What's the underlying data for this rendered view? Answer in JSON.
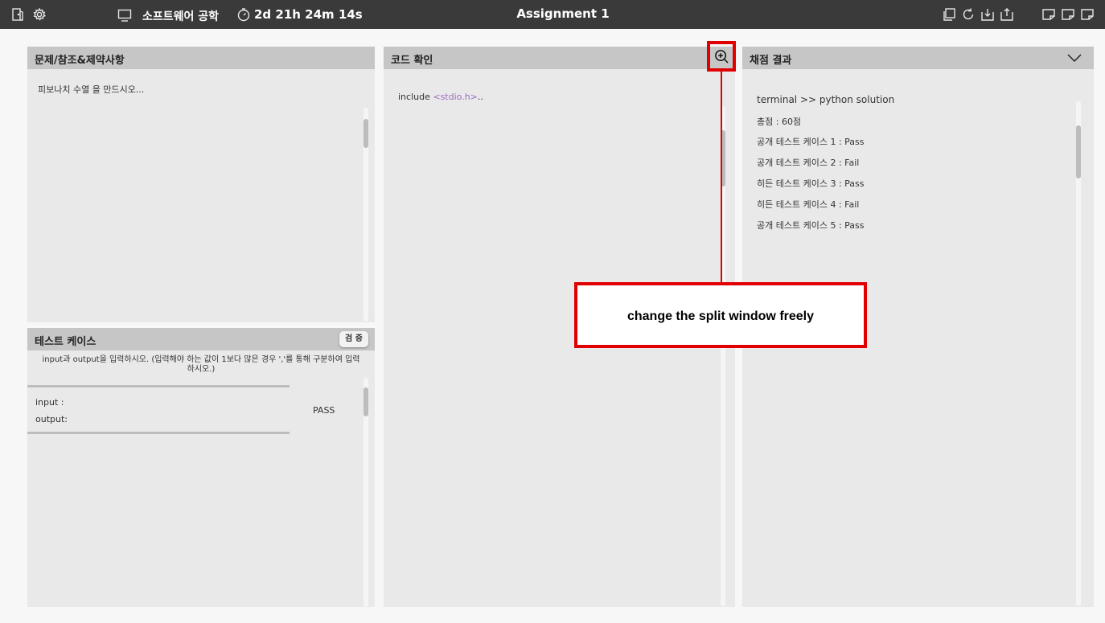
{
  "topbar": {
    "course": "소프트웨어 공학",
    "timer": "2d 21h 24m 14s",
    "title": "Assignment 1"
  },
  "problem": {
    "title": "문제/참조&제약사항",
    "text": "피보나치 수열 을 만드시오..."
  },
  "testcase": {
    "title": "테스트 케이스",
    "verify_label": "검 증",
    "instruction_line1": "input과 output을 입력하시오. (입력해야 하는 값이 1보다 많은 경우 ','를 통해 구분하여 입력",
    "instruction_line2": "하시오.)",
    "input_label": "input :",
    "output_label": "output:",
    "result": "PASS"
  },
  "code": {
    "title": "코드 확인",
    "keyword": "include ",
    "header": "<stdio.h>",
    "suffix": ".."
  },
  "grading": {
    "title": "채점 결과",
    "lines": [
      "terminal >> python solution",
      "총점 : 60점",
      "공개 테스트 케이스 1 : Pass",
      "공개 테스트 케이스 2 : Fail",
      "히든 테스트 케이스 3 : Pass",
      "히든 테스트 케이스 4 : Fail",
      "공개 테스트 케이스 5 : Pass"
    ]
  },
  "annotation": {
    "text": "change the split window freely"
  },
  "colors": {
    "topbar": "#3a3a3a",
    "panel_header": "#c6c6c6",
    "panel_body": "#e9e9e9",
    "code_header_tag": "#9a6fc0",
    "annotation": "#e00000"
  },
  "icons": [
    "exit-icon",
    "gear-icon",
    "monitor-icon",
    "timer-icon",
    "copy-icon",
    "refresh-icon",
    "download-icon",
    "upload-icon",
    "layout-1-icon",
    "layout-2-icon",
    "layout-3-icon",
    "zoom-in-icon",
    "chevron-down-icon"
  ]
}
